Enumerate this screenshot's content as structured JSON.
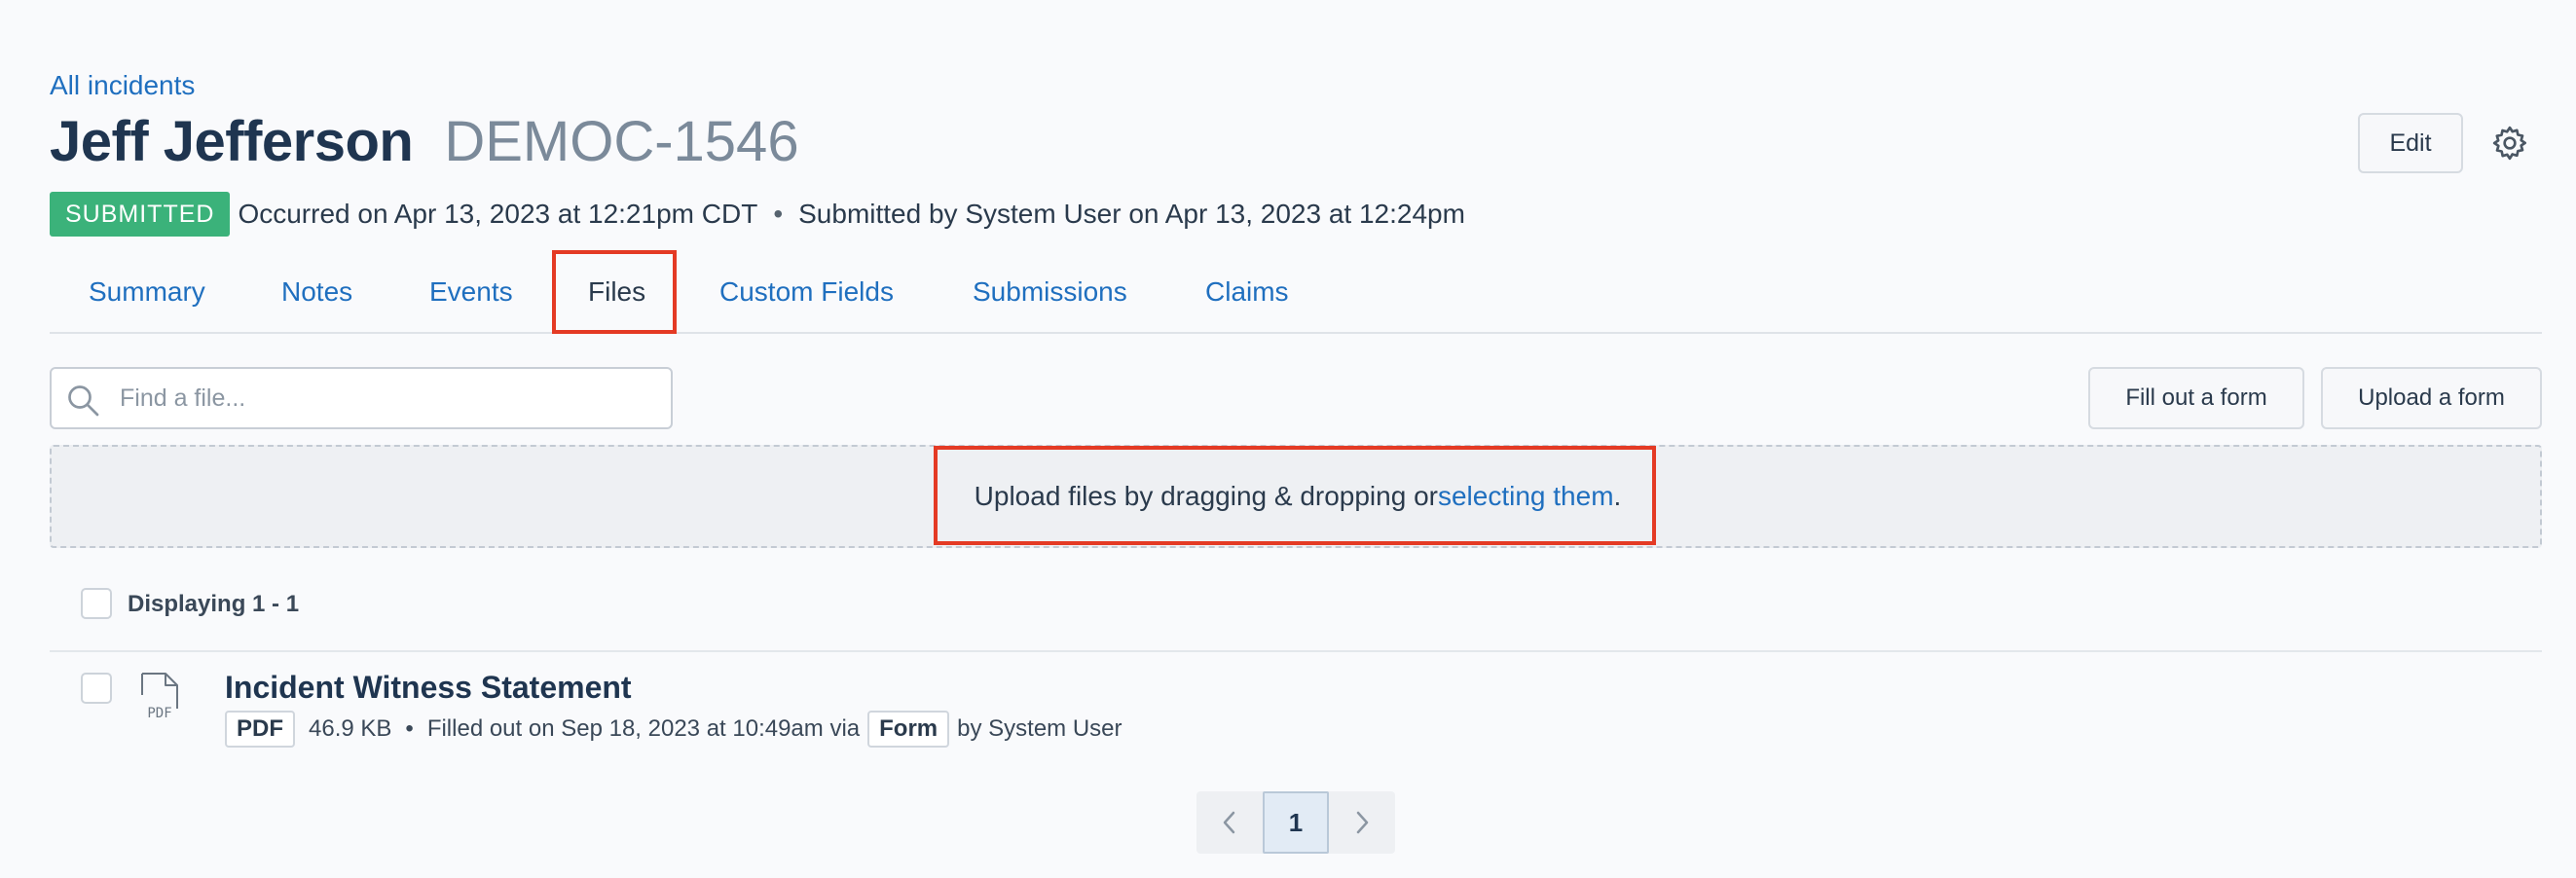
{
  "header": {
    "back_link": "All incidents",
    "person_name": "Jeff Jefferson",
    "incident_code": "DEMOC-1546",
    "edit_label": "Edit",
    "status": "SUBMITTED",
    "occurred": "Occurred on Apr 13, 2023 at 12:21pm CDT",
    "separator": "•",
    "submitted": "Submitted by System User on Apr 13, 2023 at 12:24pm"
  },
  "tabs": [
    {
      "label": "Summary"
    },
    {
      "label": "Notes"
    },
    {
      "label": "Events"
    },
    {
      "label": "Files",
      "active": true
    },
    {
      "label": "Custom Fields"
    },
    {
      "label": "Submissions"
    },
    {
      "label": "Claims"
    }
  ],
  "toolbar": {
    "search_placeholder": "Find a file...",
    "fill_form_label": "Fill out a form",
    "upload_form_label": "Upload a form"
  },
  "dropzone": {
    "text": "Upload files by dragging & dropping or ",
    "link": "selecting them",
    "end": "."
  },
  "list": {
    "displaying": "Displaying 1 - 1",
    "files": [
      {
        "title": "Incident Witness Statement",
        "type": "PDF",
        "size": "46.9 KB",
        "separator": "•",
        "filled": "Filled out on Sep 18, 2023 at 10:49am via",
        "via": "Form",
        "by": "by System User",
        "icon": "pdf-file-icon"
      }
    ]
  },
  "pagination": {
    "current": "1"
  },
  "colors": {
    "link": "#1f6fbf",
    "status_green": "#3bb27a",
    "highlight_red": "#e43a24"
  }
}
